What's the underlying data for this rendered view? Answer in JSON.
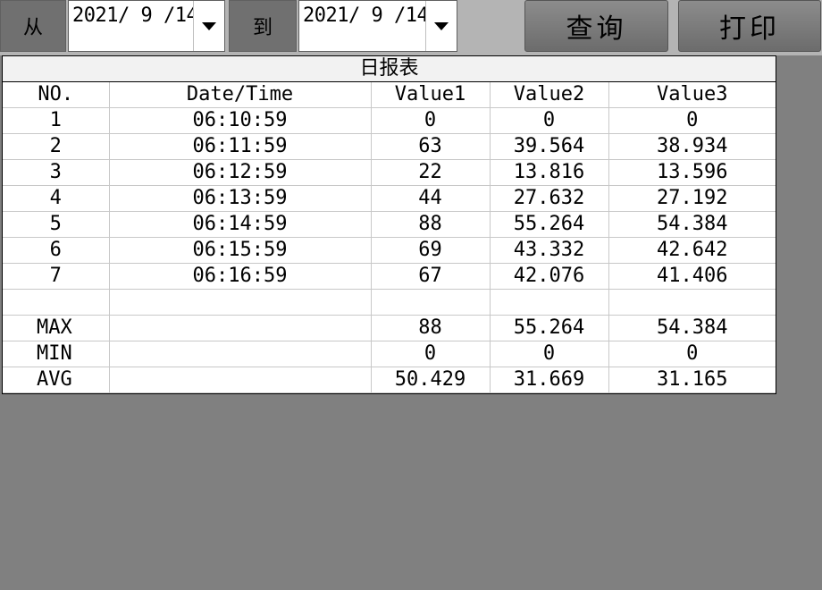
{
  "query_bar": {
    "from_label": "从",
    "from_date": "2021/ 9 /14",
    "to_label": "到",
    "to_date": "2021/ 9 /14",
    "query_button": "查询",
    "print_button": "打印"
  },
  "report": {
    "title": "日报表",
    "columns": [
      "NO.",
      "Date/Time",
      "Value1",
      "Value2",
      "Value3"
    ],
    "rows": [
      [
        "1",
        "06:10:59",
        "0",
        "0",
        "0"
      ],
      [
        "2",
        "06:11:59",
        "63",
        "39.564",
        "38.934"
      ],
      [
        "3",
        "06:12:59",
        "22",
        "13.816",
        "13.596"
      ],
      [
        "4",
        "06:13:59",
        "44",
        "27.632",
        "27.192"
      ],
      [
        "5",
        "06:14:59",
        "88",
        "55.264",
        "54.384"
      ],
      [
        "6",
        "06:15:59",
        "69",
        "43.332",
        "42.642"
      ],
      [
        "7",
        "06:16:59",
        "67",
        "42.076",
        "41.406"
      ],
      [
        "",
        "",
        "",
        "",
        ""
      ]
    ],
    "stats": [
      [
        "MAX",
        "",
        "88",
        "55.264",
        "54.384"
      ],
      [
        "MIN",
        "",
        "0",
        "0",
        "0"
      ],
      [
        "AVG",
        "",
        "50.429",
        "31.669",
        "31.165"
      ]
    ]
  },
  "colors": {
    "background": "#808080",
    "toolbar": "#b4b4b4",
    "table_bg": "#ffffff"
  }
}
